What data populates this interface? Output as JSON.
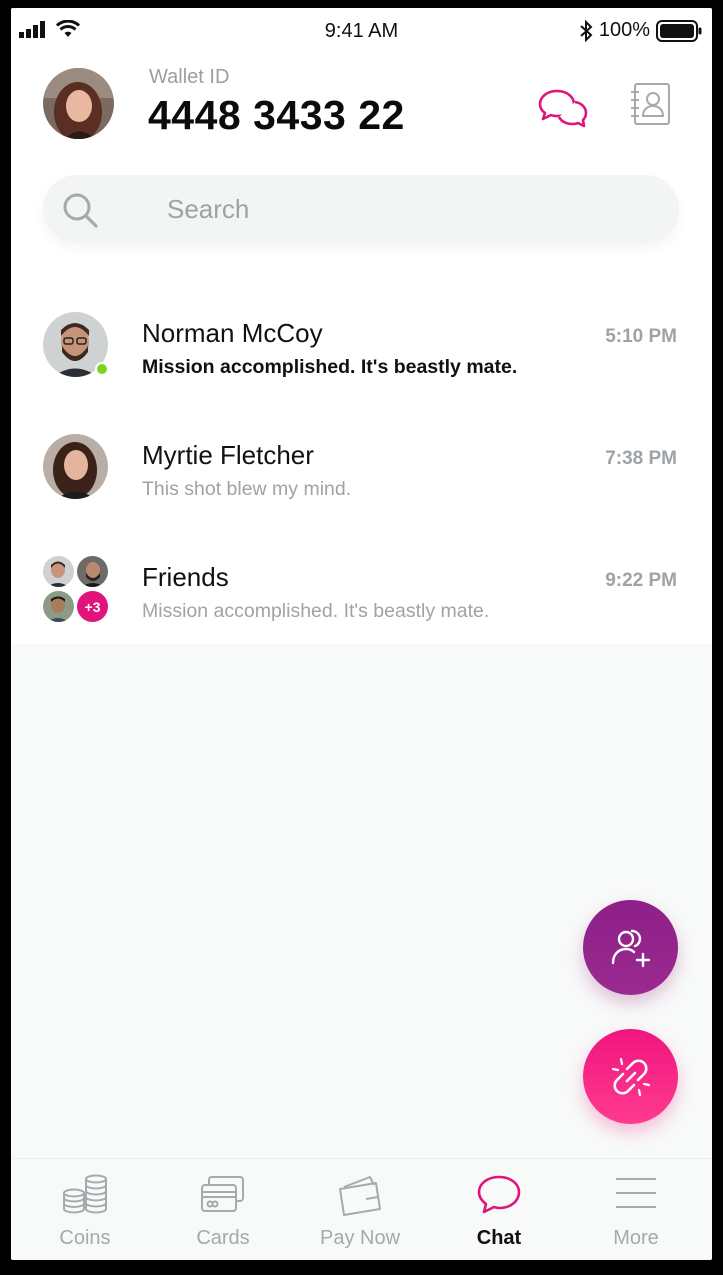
{
  "status_bar": {
    "time": "9:41 AM",
    "battery": "100%"
  },
  "header": {
    "wallet_label": "Wallet ID",
    "wallet_id": "4448 3433 22"
  },
  "search": {
    "placeholder": "Search"
  },
  "chats": [
    {
      "name": "Norman McCoy",
      "message": "Mission accomplished. It's beastly mate.",
      "time": "5:10 PM",
      "unread": true,
      "online": true
    },
    {
      "name": "Myrtie Fletcher",
      "message": "This shot blew my mind.",
      "time": "7:38 PM",
      "unread": false,
      "online": false
    },
    {
      "name": "Friends",
      "message": "Mission accomplished. It's beastly mate.",
      "time": "9:22 PM",
      "unread": false,
      "group_extra": "+3"
    }
  ],
  "tabs": [
    {
      "label": "Coins",
      "icon": "coins-icon"
    },
    {
      "label": "Cards",
      "icon": "cards-icon"
    },
    {
      "label": "Pay Now",
      "icon": "wallet-icon"
    },
    {
      "label": "Chat",
      "icon": "chat-icon",
      "active": true
    },
    {
      "label": "More",
      "icon": "menu-icon"
    }
  ],
  "colors": {
    "accent": "#e0147a",
    "fab_add": "#8e1f8a",
    "fab_link": "#f0157f",
    "online": "#7ed321"
  }
}
